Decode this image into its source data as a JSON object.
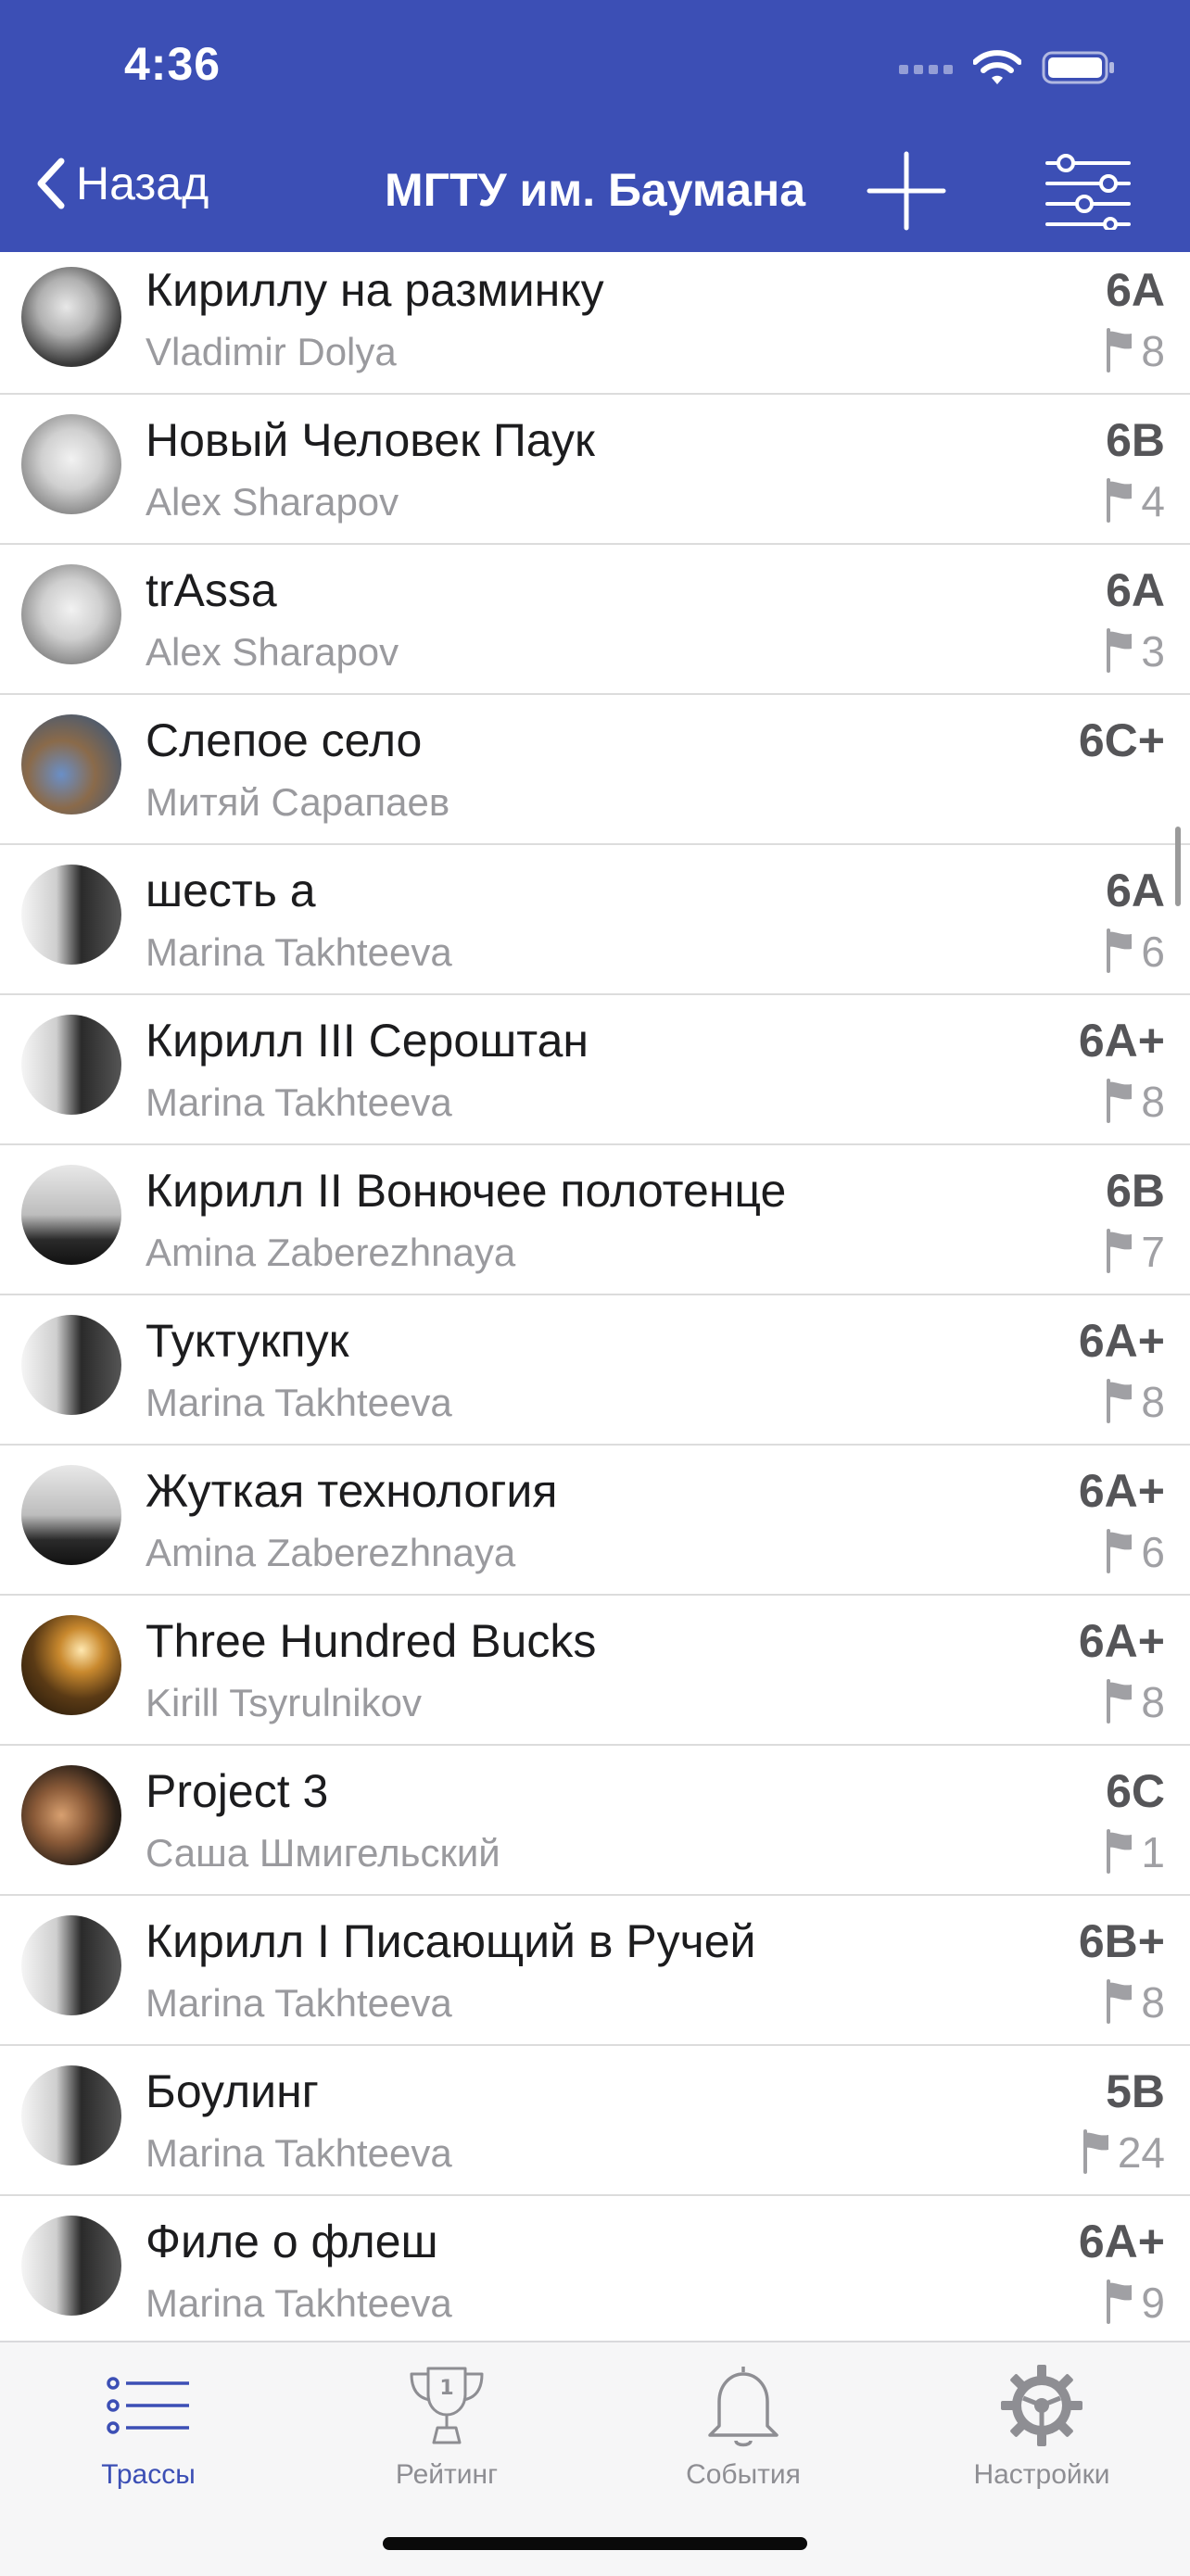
{
  "status_bar": {
    "time": "4:36"
  },
  "nav": {
    "back_label": "Назад",
    "title": "МГТУ им. Баумана"
  },
  "routes": [
    {
      "name": "Кириллу на разминку",
      "author": "Vladimir Dolya",
      "grade": "6A",
      "flags": "8"
    },
    {
      "name": "Новый Человек Паук",
      "author": "Alex Sharapov",
      "grade": "6B",
      "flags": "4"
    },
    {
      "name": "trAssa",
      "author": "Alex Sharapov",
      "grade": "6A",
      "flags": "3"
    },
    {
      "name": "Слепое село",
      "author": "Митяй Сарапаев",
      "grade": "6C+",
      "flags": ""
    },
    {
      "name": "шесть а",
      "author": "Marina Takhteeva",
      "grade": "6A",
      "flags": "6"
    },
    {
      "name": "Кирилл III Сероштан",
      "author": "Marina Takhteeva",
      "grade": "6A+",
      "flags": "8"
    },
    {
      "name": "Кирилл II Вонючее полотенце",
      "author": "Amina Zaberezhnaya",
      "grade": "6B",
      "flags": "7"
    },
    {
      "name": "Туктукпук",
      "author": "Marina Takhteeva",
      "grade": "6A+",
      "flags": "8"
    },
    {
      "name": "Жуткая технология",
      "author": "Amina Zaberezhnaya",
      "grade": "6A+",
      "flags": "6"
    },
    {
      "name": "Three Hundred Bucks",
      "author": "Kirill Tsyrulnikov",
      "grade": "6A+",
      "flags": "8"
    },
    {
      "name": "Project 3",
      "author": "Саша Шмигельский",
      "grade": "6C",
      "flags": "1"
    },
    {
      "name": "Кирилл I Писающий в Ручей",
      "author": "Marina Takhteeva",
      "grade": "6B+",
      "flags": "8"
    },
    {
      "name": "Боулинг",
      "author": "Marina Takhteeva",
      "grade": "5B",
      "flags": "24"
    },
    {
      "name": "Филе о флеш",
      "author": "Marina Takhteeva",
      "grade": "6A+",
      "flags": "9"
    }
  ],
  "tabs": [
    {
      "label": "Трассы",
      "icon": "list-icon",
      "active": true
    },
    {
      "label": "Рейтинг",
      "icon": "trophy-icon",
      "active": false
    },
    {
      "label": "События",
      "icon": "bell-icon",
      "active": false
    },
    {
      "label": "Настройки",
      "icon": "gear-icon",
      "active": false
    }
  ],
  "colors": {
    "accent": "#3c4fb5",
    "grade": "#555558",
    "secondary_text": "#9a9a9e"
  }
}
